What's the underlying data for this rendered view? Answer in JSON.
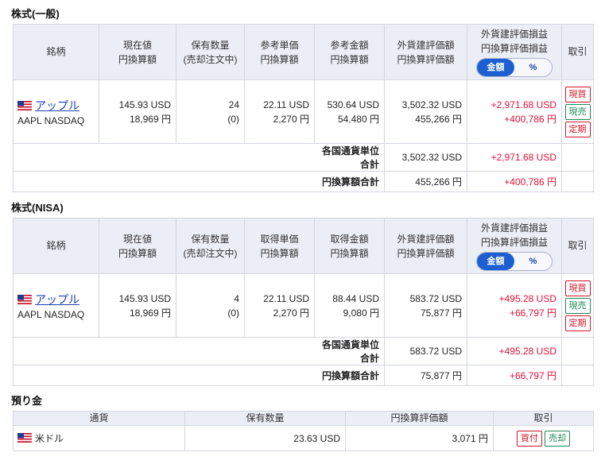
{
  "colors": {
    "positive": "#e0103a",
    "toggle_active": "#1d5fd1",
    "header_bg": "#eceef6",
    "buy": "#d4142a",
    "sell": "#1b8a55"
  },
  "headers": {
    "meigara": "銘柄",
    "genzaichi": [
      "現在値",
      "円換算額"
    ],
    "hoyu": [
      "保有数量",
      "(売却注文中)"
    ],
    "pl": [
      "外貨建評価損益",
      "円換算評価損益"
    ],
    "toggle_amount": "金額",
    "toggle_pct": "%",
    "torihiki": "取引"
  },
  "general": {
    "title": "株式(一般)",
    "unit_header": [
      "参考単価",
      "円換算額"
    ],
    "amount_header": [
      "参考金額",
      "円換算額"
    ],
    "val_header": [
      "外貨建評価額",
      "円換算評価額"
    ],
    "row": {
      "icon": "us-flag-icon",
      "name": "アップル",
      "ticker": "AAPL NASDAQ",
      "price_usd": "145.93 USD",
      "price_jpy": "18,969 円",
      "qty": "24",
      "qty_sell": "(0)",
      "unit_usd": "22.11 USD",
      "unit_jpy": "2,270 円",
      "amount_usd": "530.64 USD",
      "amount_jpy": "54,480 円",
      "val_usd": "3,502.32 USD",
      "val_jpy": "455,266 円",
      "pl_usd": "+2,971.68 USD",
      "pl_jpy": "+400,786 円",
      "btn_buy": "現買",
      "btn_sell": "現売",
      "btn_reg": "定期"
    },
    "sum1_label": "各国通貨単位合計",
    "sum1_val": "3,502.32 USD",
    "sum1_pl": "+2,971.68 USD",
    "sum2_label": "円換算額合計",
    "sum2_val": "455,266 円",
    "sum2_pl": "+400,786 円"
  },
  "nisa": {
    "title": "株式(NISA)",
    "unit_header": [
      "取得単価",
      "円換算額"
    ],
    "amount_header": [
      "取得金額",
      "円換算額"
    ],
    "val_header": [
      "外貨建評価額",
      "円換算評価額"
    ],
    "row": {
      "icon": "us-flag-icon",
      "name": "アップル",
      "ticker": "AAPL NASDAQ",
      "price_usd": "145.93 USD",
      "price_jpy": "18,969 円",
      "qty": "4",
      "qty_sell": "(0)",
      "unit_usd": "22.11 USD",
      "unit_jpy": "2,270 円",
      "amount_usd": "88.44 USD",
      "amount_jpy": "9,080 円",
      "val_usd": "583.72 USD",
      "val_jpy": "75,877 円",
      "pl_usd": "+495.28 USD",
      "pl_jpy": "+66,797 円",
      "btn_buy": "現買",
      "btn_sell": "現売",
      "btn_reg": "定期"
    },
    "sum1_label": "各国通貨単位合計",
    "sum1_val": "583.72 USD",
    "sum1_pl": "+495.28 USD",
    "sum2_label": "円換算額合計",
    "sum2_val": "75,877 円",
    "sum2_pl": "+66,797 円"
  },
  "deposit": {
    "title": "預り金",
    "headers": [
      "通貨",
      "保有数量",
      "円換算評価額",
      "取引"
    ],
    "row": {
      "icon": "us-flag-icon",
      "currency": "米ドル",
      "qty": "23.63 USD",
      "jpy": "3,071 円",
      "btn_buy": "買付",
      "btn_sell": "売却"
    }
  }
}
